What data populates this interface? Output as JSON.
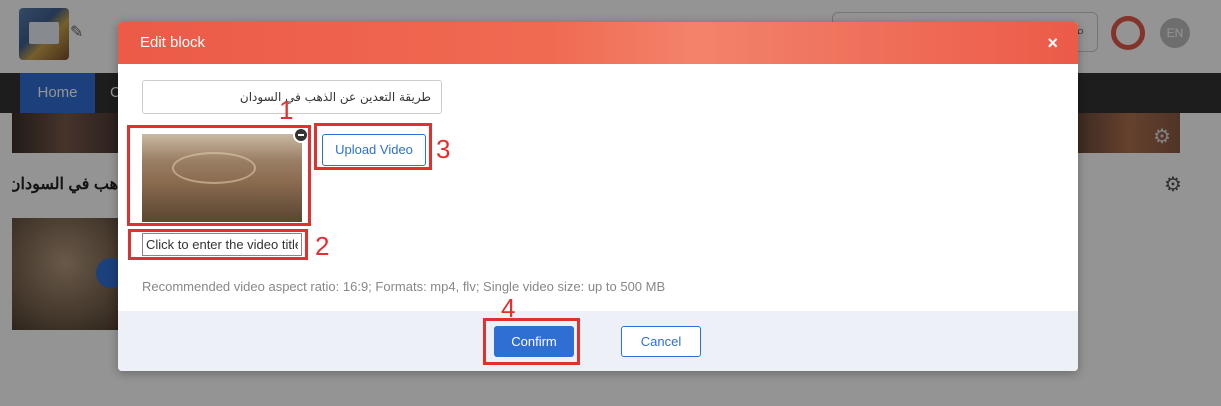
{
  "background": {
    "nav": {
      "home_label": "Home",
      "next_label": "C"
    },
    "lang_label": "EN",
    "block_title": "هب في السودان",
    "colors": {
      "nav_bg": "#333333",
      "accent": "#2f6fd4"
    }
  },
  "dialog": {
    "title": "Edit block",
    "close_symbol": "×",
    "name_value": "طريقة التعدين عن الذهب في السودان",
    "upload_label": "Upload Video",
    "video_title_placeholder": "Click to enter the video title",
    "hint": "Recommended video aspect ratio: 16:9; Formats: mp4, flv; Single video size: up to 500 MB",
    "confirm_label": "Confirm",
    "cancel_label": "Cancel",
    "header_color": "#ec5a48"
  },
  "annotations": [
    {
      "label": "1",
      "target": "video-thumbnail"
    },
    {
      "label": "2",
      "target": "video-title-input"
    },
    {
      "label": "3",
      "target": "upload-video-button"
    },
    {
      "label": "4",
      "target": "confirm-button"
    }
  ],
  "annotation_color": "#e03030"
}
